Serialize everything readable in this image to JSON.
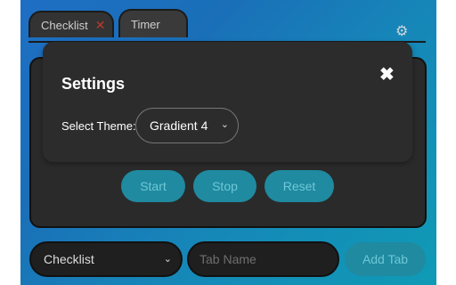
{
  "tabs": [
    {
      "label": "Checklist",
      "close": "✕"
    },
    {
      "label": "Timer"
    }
  ],
  "gear_icon": "⚙",
  "timer_buttons": {
    "start": "Start",
    "stop": "Stop",
    "reset": "Reset"
  },
  "settings": {
    "title": "Settings",
    "close_icon": "✖",
    "theme_label": "Select Theme:",
    "theme_value": "Gradient 4",
    "chevron": "⌄"
  },
  "add_bar": {
    "type_value": "Checklist",
    "chevron": "⌄",
    "tab_name_placeholder": "Tab Name",
    "add_label": "Add Tab"
  },
  "colors": {
    "accent": "#1f8aa0",
    "panel": "#2a2a2a",
    "close_x": "#c0392b"
  }
}
